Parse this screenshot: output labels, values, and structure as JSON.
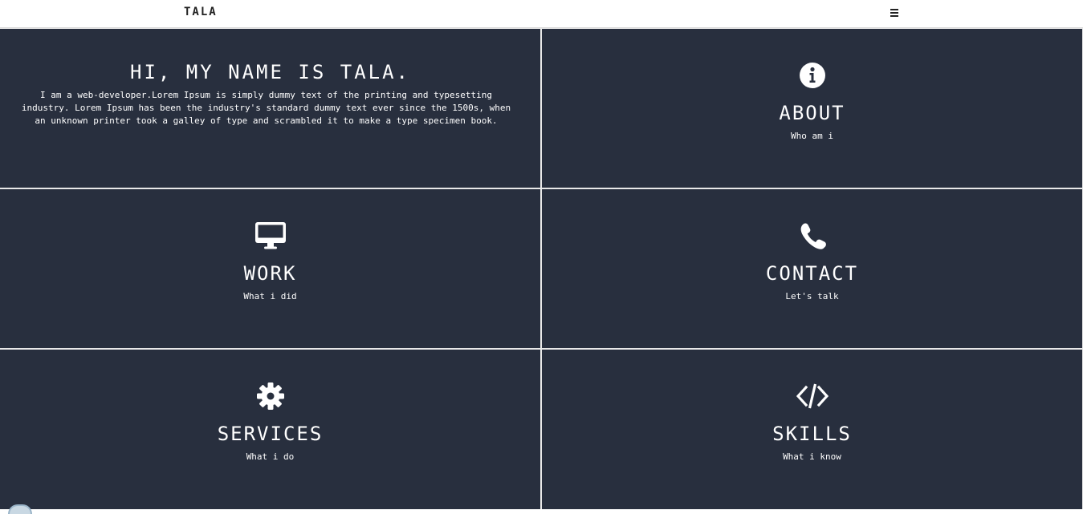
{
  "navbar": {
    "brand": "TALA",
    "menu_icon": "hamburger-icon"
  },
  "hero": {
    "title": "HI, MY NAME IS TALA.",
    "text": "I am a web-developer.Lorem Ipsum is simply dummy text of the printing and typesetting industry. Lorem Ipsum has been the industry's standard dummy text ever since the 1500s, when an unknown printer took a galley of type and scrambled it to make a type specimen book."
  },
  "tiles": [
    {
      "icon": "info-circle-icon",
      "title": "ABOUT",
      "subtitle": "Who am i"
    },
    {
      "icon": "desktop-icon",
      "title": "WORK",
      "subtitle": "What i did"
    },
    {
      "icon": "phone-icon",
      "title": "CONTACT",
      "subtitle": "Let's talk"
    },
    {
      "icon": "gear-icon",
      "title": "SERVICES",
      "subtitle": "What i do"
    },
    {
      "icon": "code-icon",
      "title": "SKILLS",
      "subtitle": "What i know"
    }
  ],
  "colors": {
    "tile_background": "#282f3e",
    "grid_lines": "#e8e8e8",
    "text": "#ffffff",
    "navbar_background": "#ffffff"
  }
}
